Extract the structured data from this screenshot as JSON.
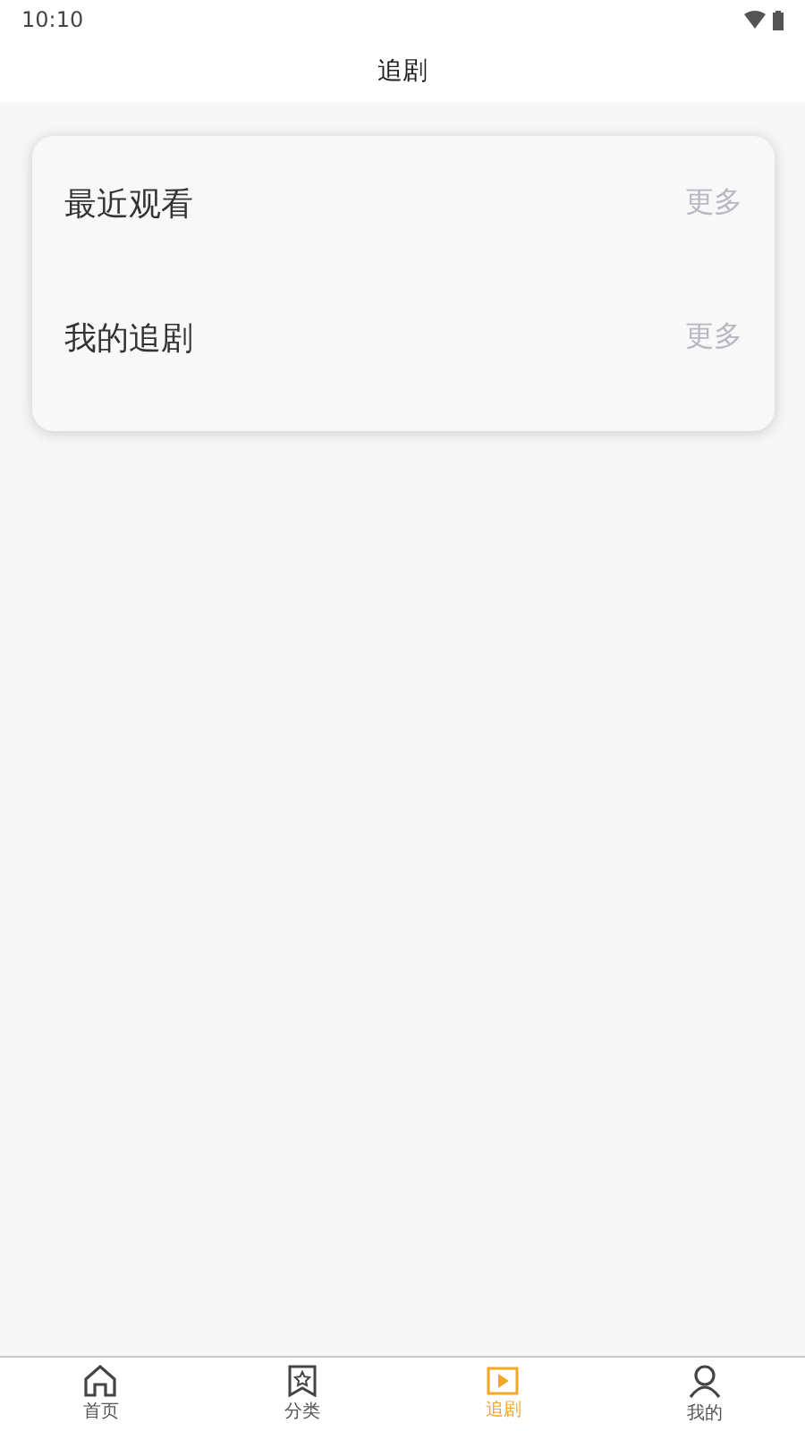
{
  "status_bar": {
    "time": "10:10"
  },
  "header": {
    "title": "追剧"
  },
  "sections": [
    {
      "title": "最近观看",
      "more": "更多"
    },
    {
      "title": "我的追剧",
      "more": "更多"
    }
  ],
  "tab_bar": [
    {
      "kind": "home",
      "label": "首页",
      "selected": false
    },
    {
      "kind": "category",
      "label": "分类",
      "selected": false
    },
    {
      "kind": "drama",
      "label": "追剧",
      "selected": true
    },
    {
      "kind": "profile",
      "label": "我的",
      "selected": false
    }
  ]
}
